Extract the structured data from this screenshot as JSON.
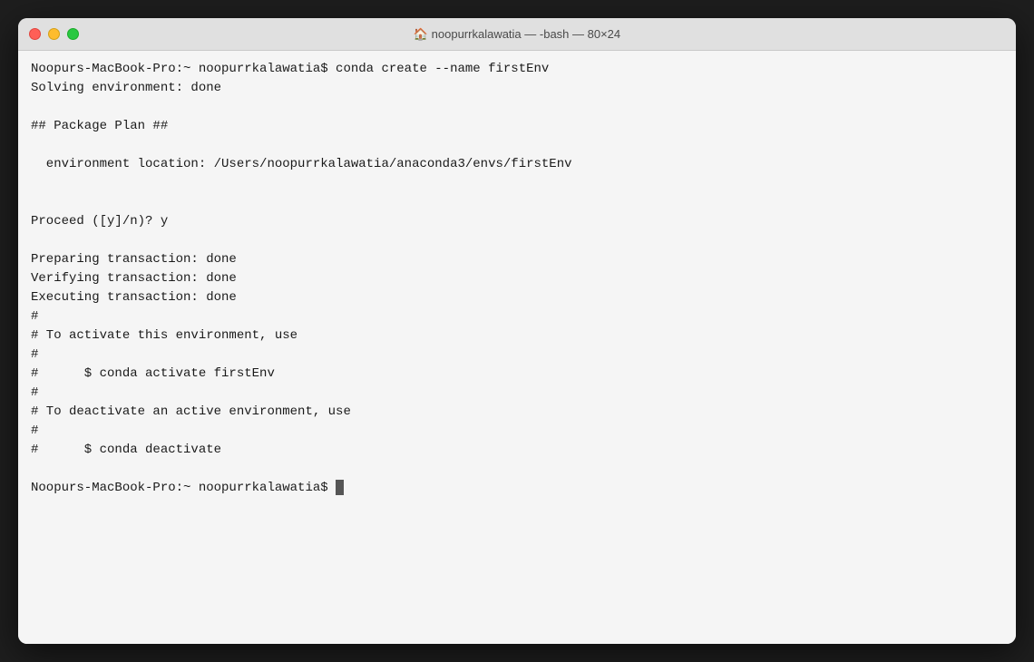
{
  "window": {
    "title": "🏠 noopurrkalawatia — -bash — 80×24",
    "traffic_lights": {
      "close_label": "close",
      "minimize_label": "minimize",
      "maximize_label": "maximize"
    }
  },
  "terminal": {
    "lines": [
      "Noopurs-MacBook-Pro:~ noopurrkalawatia$ conda create --name firstEnv",
      "Solving environment: done",
      "",
      "## Package Plan ##",
      "",
      "  environment location: /Users/noopurrkalawatia/anaconda3/envs/firstEnv",
      "",
      "",
      "Proceed ([y]/n)? y",
      "",
      "Preparing transaction: done",
      "Verifying transaction: done",
      "Executing transaction: done",
      "#",
      "# To activate this environment, use",
      "#",
      "#      $ conda activate firstEnv",
      "#",
      "# To deactivate an active environment, use",
      "#",
      "#      $ conda deactivate",
      "",
      "Noopurs-MacBook-Pro:~ noopurrkalawatia$ "
    ]
  }
}
